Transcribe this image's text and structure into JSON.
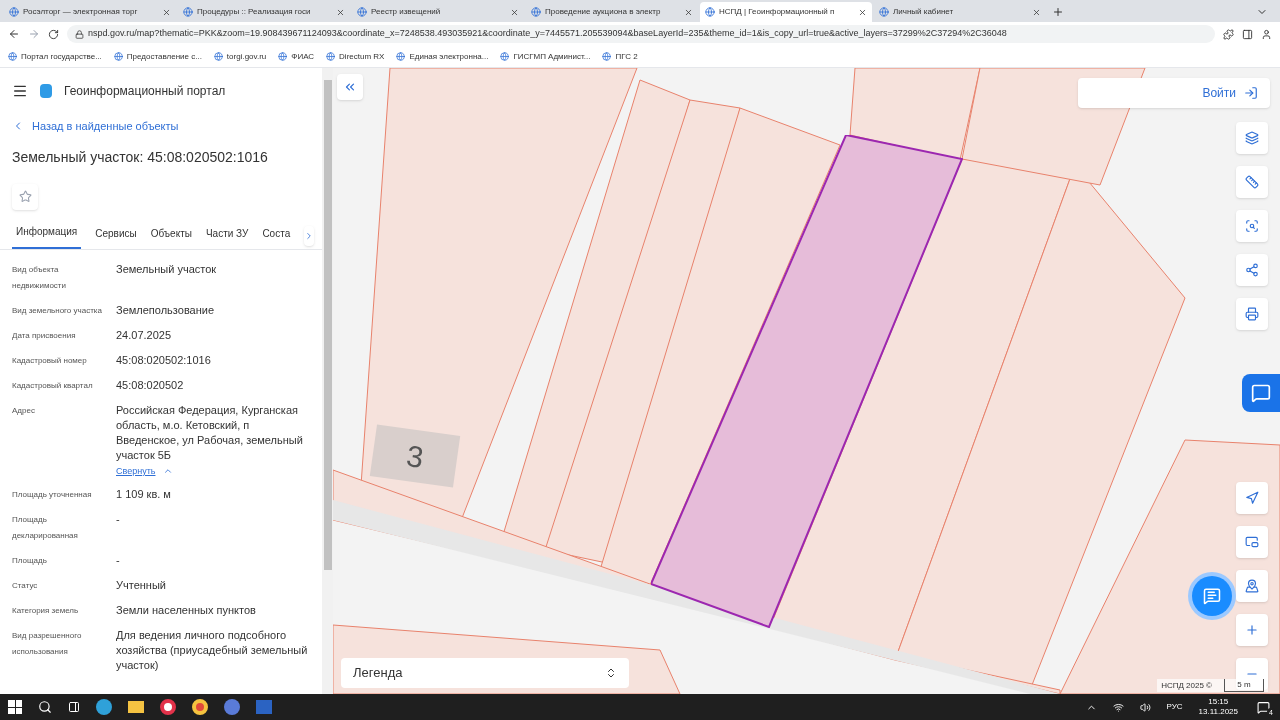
{
  "browser": {
    "tabs": [
      {
        "label": "Росэлторг — электронная торг",
        "selected": false
      },
      {
        "label": "Процедуры :: Реализация госи",
        "selected": false
      },
      {
        "label": "Реестр извещений",
        "selected": false
      },
      {
        "label": "Проведение аукциона в электр",
        "selected": false
      },
      {
        "label": "НСПД | Геоинформационный п",
        "selected": true
      },
      {
        "label": "Личный кабинет",
        "selected": false
      }
    ],
    "url": "nspd.gov.ru/map?thematic=PKK&zoom=19.908439671124093&coordinate_x=7248538.493035921&coordinate_y=7445571.205539094&baseLayerId=235&theme_id=1&is_copy_url=true&active_layers=37299%2C37294%2C36048",
    "bookmarks": [
      "Портал государстве...",
      "Предоставление с...",
      "torgi.gov.ru",
      "ФИАС",
      "Directum RX",
      "Единая электронна...",
      "ГИСГМП Админист...",
      "ПГС 2"
    ]
  },
  "portal": {
    "title": "Геоинформационный портал",
    "back_link": "Назад в найденные объекты",
    "heading": "Земельный участок: 45:08:020502:1016",
    "tabs": [
      {
        "label": "Информация",
        "selected": true
      },
      {
        "label": "Сервисы",
        "selected": false
      },
      {
        "label": "Объекты",
        "selected": false
      },
      {
        "label": "Части ЗУ",
        "selected": false
      },
      {
        "label": "Соста",
        "selected": false
      }
    ],
    "fields": [
      {
        "label": "Вид объекта недвижимости",
        "value": "Земельный участок"
      },
      {
        "label": "Вид земельного участка",
        "value": "Землепользование"
      },
      {
        "label": "Дата присвоения",
        "value": "24.07.2025"
      },
      {
        "label": "Кадастровый номер",
        "value": "45:08:020502:1016"
      },
      {
        "label": "Кадастровый квартал",
        "value": "45:08:020502"
      },
      {
        "label": "Адрес",
        "value": "Российская Федерация, Курганская область, м.о. Кетовский, п Введенское, ул Рабочая, земельный участок 5Б",
        "link": "Свернуть"
      },
      {
        "label": "Площадь уточненная",
        "value": "1 109 кв. м"
      },
      {
        "label": "Площадь декларированная",
        "value": "-"
      },
      {
        "label": "Площадь",
        "value": "-"
      },
      {
        "label": "Статус",
        "value": "Учтенный"
      },
      {
        "label": "Категория земель",
        "value": "Земли населенных пунктов"
      },
      {
        "label": "Вид разрешенного использования",
        "value": "Для ведения личного подсобного хозяйства (приусадебный земельный участок)"
      }
    ]
  },
  "map": {
    "login": "Войти",
    "house_number": "3",
    "legend": "Легенда",
    "attribution": "НСПД 2025 ©",
    "scale": "5 m"
  },
  "taskbar": {
    "language": "РУС",
    "time": "15:15",
    "date": "13.11.2025",
    "notifications": "4"
  }
}
